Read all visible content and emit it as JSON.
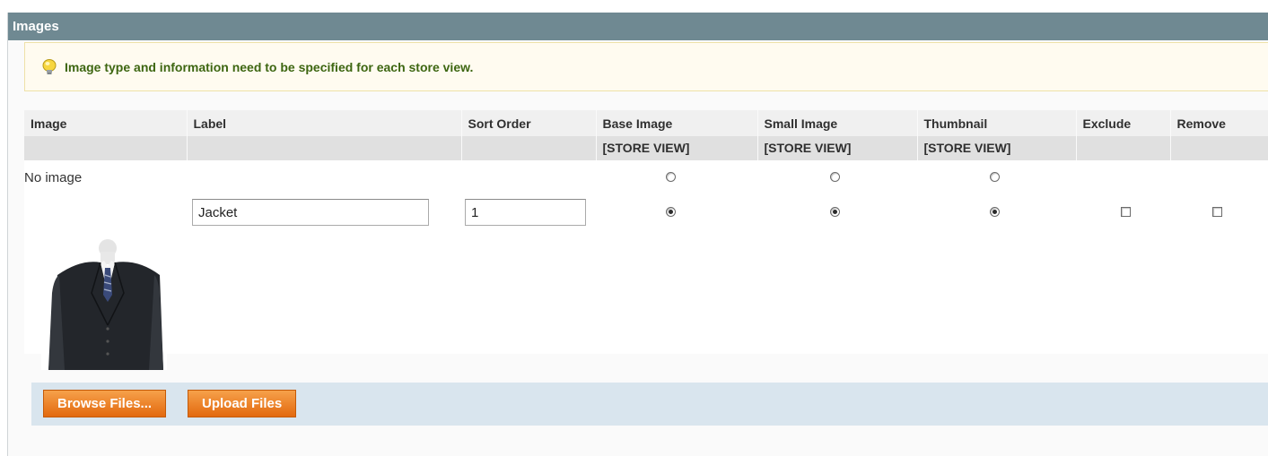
{
  "panel": {
    "title": "Images"
  },
  "notice": {
    "icon": "lightbulb-icon",
    "text": "Image type and information need to be specified for each store view."
  },
  "columns": {
    "image": "Image",
    "label": "Label",
    "sort_order": "Sort Order",
    "base_image": "Base Image",
    "small_image": "Small Image",
    "thumbnail": "Thumbnail",
    "exclude": "Exclude",
    "remove": "Remove",
    "scope": "[STORE VIEW]"
  },
  "rows": {
    "no_image": {
      "text": "No image",
      "base_image": false,
      "small_image": false,
      "thumbnail": false
    },
    "image": {
      "thumbnail_icon": "jacket-image",
      "label": "Jacket",
      "sort_order": "1",
      "base_image": true,
      "small_image": true,
      "thumbnail": true,
      "exclude": false,
      "remove": false
    }
  },
  "actions": {
    "browse_label": "Browse Files...",
    "upload_label": "Upload Files"
  },
  "colors": {
    "header_bg": "#6f8992",
    "notice_text": "#3d6611",
    "button_orange": "#e3690f",
    "actions_bar": "#d9e5ee"
  }
}
